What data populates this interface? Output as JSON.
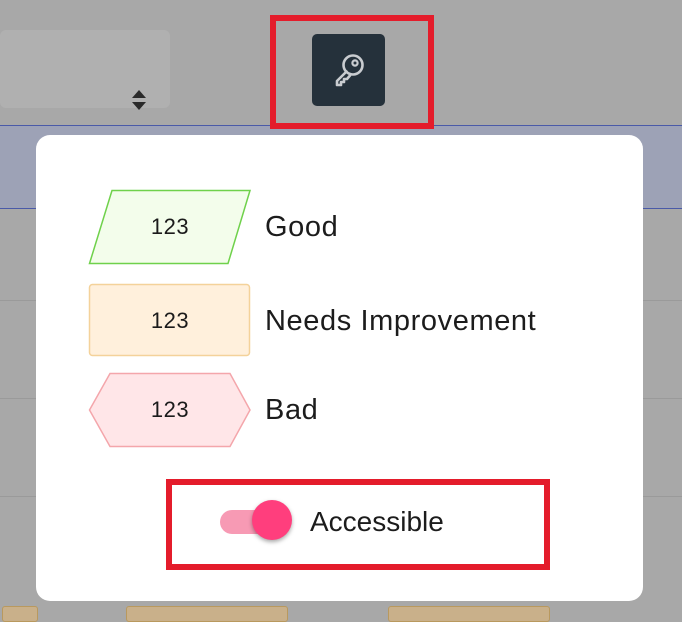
{
  "toolbar": {
    "key_icon": "key-icon",
    "sort_icon": "sort-updown-icon"
  },
  "legend": {
    "items": [
      {
        "value": "123",
        "label": "Good",
        "shape": "parallelogram",
        "fill": "#f3fdeb",
        "stroke": "#6fd14b"
      },
      {
        "value": "123",
        "label": "Needs Improvement",
        "shape": "rectangle",
        "fill": "#fff0dc",
        "stroke": "#f4d29a"
      },
      {
        "value": "123",
        "label": "Bad",
        "shape": "hexagon",
        "fill": "#ffe6e8",
        "stroke": "#f4a6ab"
      }
    ]
  },
  "accessibility": {
    "label": "Accessible",
    "enabled": true,
    "track_color": "#f79ab4",
    "knob_color": "#ff3e7d"
  },
  "highlights": {
    "color": "#e41c2b"
  }
}
